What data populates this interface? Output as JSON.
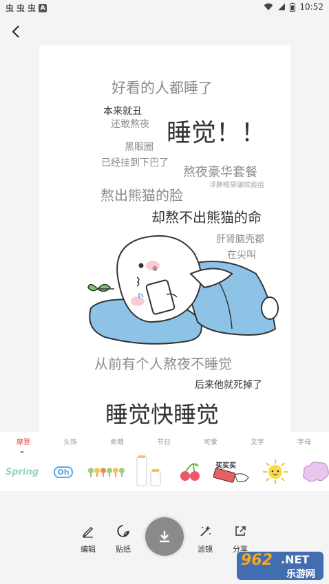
{
  "status_bar": {
    "time": "10:52",
    "left_icon_letter": "A"
  },
  "canvas_text": {
    "line1": "好看的人都睡了",
    "line2": "本来就丑",
    "line3": "还敢熬夜",
    "line4": "睡觉！！",
    "line5": "黑眼圈",
    "line6": "已经挂到下巴了",
    "line7": "熬夜豪华套餐",
    "line8": "浮肿眼袋皱纹痘痘",
    "line9": "熬出熊猫的脸",
    "line10": "却熬不出熊猫的命",
    "line11": "肝肾脑壳都",
    "line12": "在尖叫",
    "line13": "从前有个人熬夜不睡觉",
    "line14": "后来他就死掉了",
    "line15": "睡觉快睡觉"
  },
  "tabs": [
    {
      "label": "摩登",
      "active": true
    },
    {
      "label": "头饰",
      "active": false
    },
    {
      "label": "卖萌",
      "active": false
    },
    {
      "label": "节日",
      "active": false
    },
    {
      "label": "可爱",
      "active": false
    },
    {
      "label": "文字",
      "active": false
    },
    {
      "label": "字母",
      "active": false
    }
  ],
  "stickers": {
    "spring_text": "Spring",
    "oh_text": "Oh",
    "buy_text": "买买买"
  },
  "toolbar": {
    "edit_label": "编辑",
    "sticker_label": "贴纸",
    "filter_label": "滤镜",
    "share_label": "分享"
  },
  "watermark": {
    "number": "962",
    "suffix": ".NET",
    "site": "乐游网"
  },
  "colors": {
    "accent": "#e8443c",
    "pillow": "#8ec3e8",
    "download": "#8a8a8a"
  }
}
